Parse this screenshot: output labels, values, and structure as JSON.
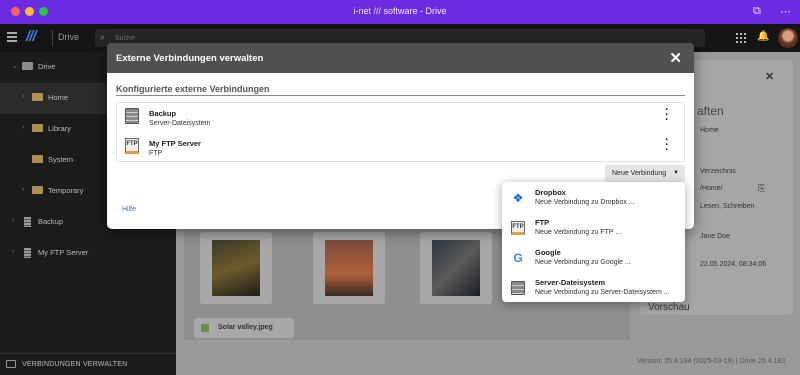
{
  "window": {
    "title": "i-net /// software - Drive"
  },
  "toolbar": {
    "app_label": "Drive",
    "search_placeholder": "Suche"
  },
  "sidebar": {
    "items": [
      {
        "label": "Drive"
      },
      {
        "label": "Home"
      },
      {
        "label": "Library"
      },
      {
        "label": "System"
      },
      {
        "label": "Temporary"
      },
      {
        "label": "Backup"
      },
      {
        "label": "My FTP Server"
      }
    ],
    "footer_label": "VERBINDUNGEN VERWALTEN"
  },
  "background": {
    "file_name": "Solar valley.jpeg",
    "panel": {
      "heading": "aften",
      "home": "Home",
      "type": "Verzeichnis",
      "path": "/Home/",
      "permissions": "Lesen, Schreiben",
      "owner": "Jane Doe",
      "date": "22.05.2024, 08:34:06",
      "preview": "Vorschau"
    },
    "version": "Version: 25.4.184 (2025-03-19) | Drive 25.4.183"
  },
  "modal": {
    "title": "Externe Verbindungen verwalten",
    "section_title": "Konfigurierte externe Verbindungen",
    "connections": [
      {
        "name": "Backup",
        "type": "Server-Dateisystem",
        "icon": "server-icon"
      },
      {
        "name": "My FTP Server",
        "type": "FTP",
        "icon": "ftp-icon"
      }
    ],
    "new_button_label": "Neue Verbindung",
    "help_label": "Hilfe"
  },
  "dropdown": {
    "items": [
      {
        "name": "Dropbox",
        "desc": "Neue Verbindung zu Dropbox ...",
        "icon": "dropbox-icon"
      },
      {
        "name": "FTP",
        "desc": "Neue Verbindung zu FTP ...",
        "icon": "ftp-icon"
      },
      {
        "name": "Google",
        "desc": "Neue Verbindung zu Google ...",
        "icon": "google-icon"
      },
      {
        "name": "Server-Dateisystem",
        "desc": "Neue Verbindung zu Server-Dateisystem ...",
        "icon": "server-icon"
      }
    ]
  },
  "colors": {
    "titlebar": "#6b2be0",
    "accent_link": "#3a78c8",
    "modal_header": "#505050"
  }
}
